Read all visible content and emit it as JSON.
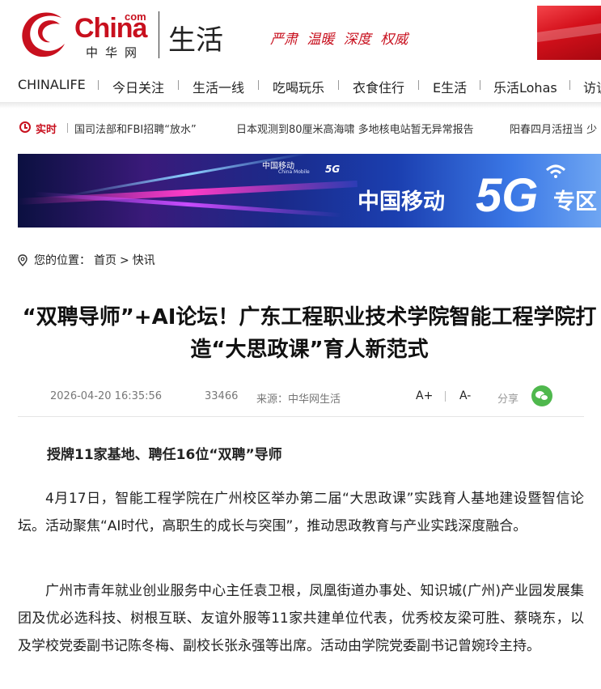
{
  "header": {
    "logo": {
      "name": "China",
      "com": "com",
      "cn": "中华网"
    },
    "channel": "生活",
    "slogan": "严肃  温暖  深度  权威"
  },
  "nav": {
    "items": [
      "CHINALIFE",
      "今日关注",
      "生活一线",
      "吃喝玩乐",
      "衣食住行",
      "E生活",
      "乐活Lohas",
      "访谈"
    ]
  },
  "ticker": {
    "label": "实时",
    "items": [
      "国司法部和FBI招聘“放水”",
      "日本观测到80厘米高海啸 多地核电站暂无异常报告",
      "阳春四月活扭当 少"
    ]
  },
  "ad": {
    "brand": "中国移动",
    "brand_en": "China Mobile",
    "tag": "5G",
    "headline": "中国移动",
    "headline_5g": "5G",
    "headline_tail": "专区"
  },
  "breadcrumb": {
    "label": "您的位置：",
    "home": "首页",
    "sep": ">",
    "current": "快讯"
  },
  "article": {
    "title": "“双聘导师”+AI论坛！广东工程职业技术学院智能工程学院打造“大思政课”育人新范式",
    "date": "2026-04-20 16:35:56",
    "views": "33466",
    "source": "来源：中华网生活",
    "font_increase": "A+",
    "font_decrease": "A-",
    "share": "分享",
    "subhead": "授牌11家基地、聘任16位“双聘”导师",
    "paragraphs": [
      "4月17日，智能工程学院在广州校区举办第二届“大思政课”实践育人基地建设暨智信论坛。活动聚焦“AI时代，高职生的成长与突围”，推动思政教育与产业实践深度融合。",
      "广州市青年就业创业服务中心主任袁卫根，凤凰街道办事处、知识城(广州)产业园发展集团及优必选科技、树根互联、友谊外服等11家共建单位代表，优秀校友梁可胜、蔡晓东，以及学校党委副书记陈冬梅、副校长张永强等出席。活动由学院党委副书记曾婉玲主持。"
    ]
  },
  "colors": {
    "brand": "#c8101e",
    "wechat": "#4fb84d"
  }
}
